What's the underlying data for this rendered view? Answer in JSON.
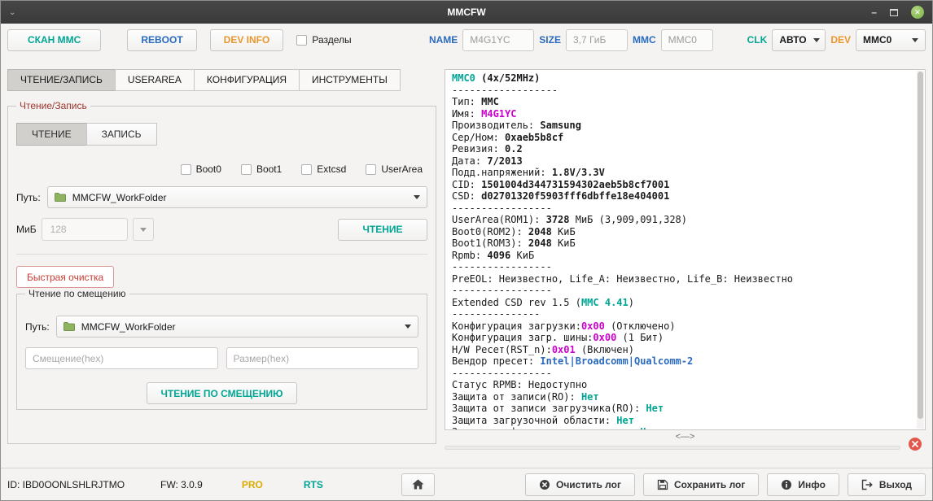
{
  "window": {
    "title": "MMCFW"
  },
  "colors": {
    "accent_teal": "#00a693",
    "accent_blue": "#2a6bbf",
    "accent_orange": "#e8972d",
    "accent_red": "#cc3b33",
    "accent_magenta": "#cc00cc",
    "accent_yellow": "#d8ac00",
    "close_button_green": "#7cb342"
  },
  "toolbar": {
    "scan_label": "СКАН ММС",
    "reboot_label": "REBOOT",
    "dev_info_label": "DEV INFO",
    "partitions_label": "Разделы",
    "name_label": "NAME",
    "name_value": "M4G1YC",
    "size_label": "SIZE",
    "size_value": "3,7 ГиБ",
    "mmc_label": "MMC",
    "mmc_value": "MMC0",
    "clk_label": "CLK",
    "clk_value": "АВТО",
    "dev_label": "DEV",
    "dev_value": "MMC0"
  },
  "tabs": [
    "ЧТЕНИЕ/ЗАПИСЬ",
    "USERAREA",
    "КОНФИГУРАЦИЯ",
    "ИНСТРУМЕНТЫ"
  ],
  "read_write": {
    "group_title": "Чтение/Запись",
    "mode_read": "ЧТЕНИЕ",
    "mode_write": "ЗАПИСЬ",
    "checkboxes": [
      "Boot0",
      "Boot1",
      "Extcsd",
      "UserArea"
    ],
    "path_label": "Путь:",
    "path_value": "MMCFW_WorkFolder",
    "mib_label": "МиБ",
    "mib_value": "128",
    "read_button": "ЧТЕНИЕ",
    "quick_erase_button": "Быстрая очистка",
    "offset": {
      "group_title": "Чтение по смещению",
      "path_label": "Путь:",
      "path_value": "MMCFW_WorkFolder",
      "offset_placeholder": "Смещение(hex)",
      "size_placeholder": "Размер(hex)",
      "button": "ЧТЕНИЕ ПО СМЕЩЕНИЮ"
    }
  },
  "log": {
    "resize_glyph": "<—>",
    "lines": [
      [
        [
          "MMC0",
          "teal"
        ],
        [
          " (4x/52MHz)",
          "b"
        ]
      ],
      [
        [
          "------------------"
        ]
      ],
      [
        [
          "Тип: "
        ],
        [
          "MMC",
          "b"
        ]
      ],
      [
        [
          "Имя: "
        ],
        [
          "M4G1YC",
          "mag"
        ]
      ],
      [
        [
          "Производитель: "
        ],
        [
          "Samsung",
          "b"
        ]
      ],
      [
        [
          "Сер/Ном: "
        ],
        [
          "0xaeb5b8cf",
          "b"
        ]
      ],
      [
        [
          "Ревизия: "
        ],
        [
          "0.2",
          "b"
        ]
      ],
      [
        [
          "Дата: "
        ],
        [
          "7/2013",
          "b"
        ]
      ],
      [
        [
          "Подд.напряжений: "
        ],
        [
          "1.8V/3.3V",
          "b"
        ]
      ],
      [
        [
          "CID: "
        ],
        [
          "1501004d344731594302aeb5b8cf7001",
          "b"
        ]
      ],
      [
        [
          "CSD: "
        ],
        [
          "d02701320f5903fff6dbffe18e404001",
          "b"
        ]
      ],
      [
        [
          "-----------------"
        ]
      ],
      [
        [
          "UserArea(ROM1): "
        ],
        [
          "3728",
          "b"
        ],
        [
          " МиБ (3,909,091,328)"
        ]
      ],
      [
        [
          "Boot0(ROM2): "
        ],
        [
          "2048",
          "b"
        ],
        [
          " КиБ"
        ]
      ],
      [
        [
          "Boot1(ROM3): "
        ],
        [
          "2048",
          "b"
        ],
        [
          " КиБ"
        ]
      ],
      [
        [
          "Rpmb: "
        ],
        [
          "4096",
          "b"
        ],
        [
          " КиБ"
        ]
      ],
      [
        [
          "-----------------"
        ]
      ],
      [
        [
          "PreEOL: Неизвестно, Life_A: Неизвестно, Life_B: Неизвестно"
        ]
      ],
      [
        [
          "-----------------"
        ]
      ],
      [
        [
          "Extended CSD rev 1.5 ("
        ],
        [
          "MMC 4.41",
          "teal"
        ],
        [
          ")"
        ]
      ],
      [
        [
          "---------------"
        ]
      ],
      [
        [
          "Конфигурация загрузки:"
        ],
        [
          "0x00",
          "mag"
        ],
        [
          " (Отключено)"
        ]
      ],
      [
        [
          "Конфигурация загр. шины:"
        ],
        [
          "0x00",
          "mag"
        ],
        [
          " (1 Бит)"
        ]
      ],
      [
        [
          "H/W Ресет(RST_n):"
        ],
        [
          "0x01",
          "mag"
        ],
        [
          " (Включен)"
        ]
      ],
      [
        [
          "Вендор пресет: "
        ],
        [
          "Intel|Broadcomm|Qualcomm-2",
          "blue"
        ]
      ],
      [
        [
          "-----------------"
        ]
      ],
      [
        [
          "Статус RPMB: Недоступно"
        ]
      ],
      [
        [
          "Защита от записи(RO): "
        ],
        [
          "Нет",
          "teal"
        ]
      ],
      [
        [
          "Защита от записи загрузчика(RO): "
        ],
        [
          "Нет",
          "teal"
        ]
      ],
      [
        [
          "Защита загрузочной области: "
        ],
        [
          "Нет",
          "teal"
        ]
      ],
      [
        [
          "Защита конфигурации загрузчика: "
        ],
        [
          "Нет",
          "teal"
        ]
      ]
    ]
  },
  "statusbar": {
    "id": "ID: IBD0OONLSHLRJTMO",
    "fw": "FW: 3.0.9",
    "pro": "PRO",
    "rts": "RTS",
    "clear_log": "Очистить лог",
    "save_log": "Сохранить лог",
    "info": "Инфо",
    "exit": "Выход"
  }
}
